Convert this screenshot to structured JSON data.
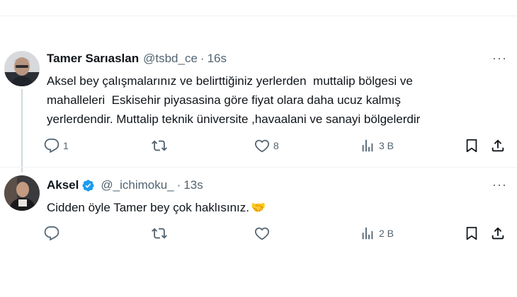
{
  "tweets": [
    {
      "author_name": "Tamer Sarıaslan",
      "handle": "@tsbd_ce",
      "separator": "·",
      "time": "16s",
      "more": "···",
      "lines": [
        "Aksel bey çalışmalarınız ve belirttiğiniz yerlerden  muttalip bölgesi ve",
        "mahalleleri  Eskisehir piyasasina göre fiyat olara daha ucuz kalmış",
        "yerlerdendir. Muttalip teknik üniversite ,havaalani ve sanayi bölgelerdir"
      ],
      "reply_count": "1",
      "retweet_count": "",
      "like_count": "8",
      "views_count": "3 B"
    },
    {
      "author_name": "Aksel",
      "verified": true,
      "handle": "@_ichimoku_",
      "separator": "·",
      "time": "13s",
      "more": "···",
      "lines": [
        "Cidden öyle Tamer bey çok haklısınız."
      ],
      "emoji": "🤝",
      "reply_count": "",
      "retweet_count": "",
      "like_count": "",
      "views_count": "2 B"
    }
  ],
  "colors": {
    "text": "#0f1419",
    "secondary": "#536471",
    "verified_blue": "#1d9bf0",
    "divider": "#eff3f4",
    "thread_line": "#cfd9de",
    "handshake_emoji": "#f4b400"
  },
  "icons": [
    "reply-icon",
    "retweet-icon",
    "like-icon",
    "views-icon",
    "bookmark-icon",
    "share-icon",
    "more-icon",
    "verified-badge-icon"
  ]
}
